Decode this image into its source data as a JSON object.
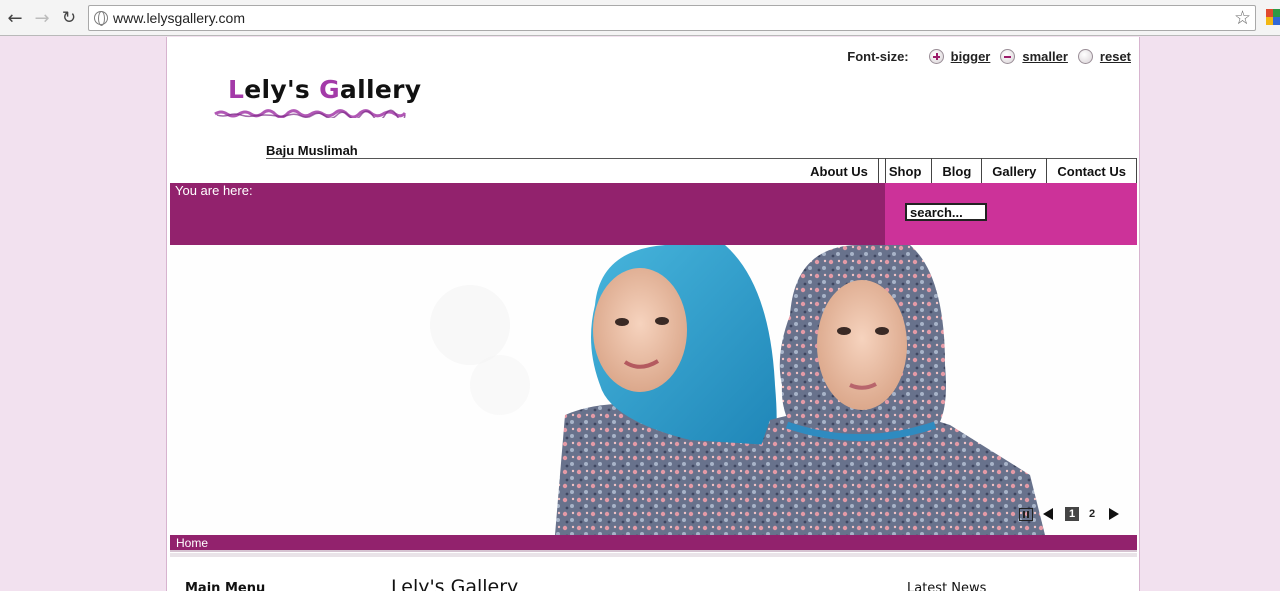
{
  "browser": {
    "url": "www.lelysgallery.com"
  },
  "font_size": {
    "label": "Font-size:",
    "bigger": "bigger",
    "smaller": "smaller",
    "reset": "reset"
  },
  "logo": {
    "first_initial": "L",
    "first_rest": "ely's ",
    "second_initial": "G",
    "second_rest": "allery",
    "accent_color": "#a33aa8"
  },
  "tagline": "Baju Muslimah",
  "menu": [
    "About Us",
    "Shop",
    "Blog",
    "Gallery",
    "Contact Us"
  ],
  "breadcrumb": {
    "label": "You are here:"
  },
  "search": {
    "value": "search..."
  },
  "slideshow": {
    "pages": [
      "1",
      "2"
    ],
    "active_page": "1"
  },
  "home_bar": "Home",
  "columns": {
    "left_title": "Main Menu",
    "center_title": "Lely's Gallery",
    "right_title": "Latest News"
  },
  "colors": {
    "bar_dark": "#92226d",
    "bar_bright": "#cc3299",
    "page_background": "#f2e1ef"
  }
}
